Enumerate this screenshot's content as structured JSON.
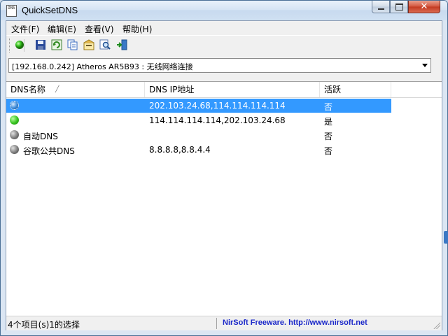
{
  "window": {
    "title": "QuickSetDNS",
    "icon_text": "DNS"
  },
  "menu": [
    "文件(F)",
    "编辑(E)",
    "查看(V)",
    "帮助(H)"
  ],
  "toolbar": [
    "activate-icon",
    "save-icon",
    "refresh-icon",
    "copy-icon",
    "properties-icon",
    "find-icon",
    "exit-icon"
  ],
  "adapter_select": {
    "value": "[192.168.0.242]  Atheros AR5B93 : 无线网络连接"
  },
  "columns": {
    "name": "DNS名称",
    "ip": "DNS IP地址",
    "active": "活跃"
  },
  "rows": [
    {
      "name": "",
      "ip": "202.103.24.68,114.114.114.114",
      "active": "否",
      "status": "blue",
      "selected": true
    },
    {
      "name": "",
      "ip": "114.114.114.114,202.103.24.68",
      "active": "是",
      "status": "green",
      "selected": false
    },
    {
      "name": "自动DNS",
      "ip": "",
      "active": "否",
      "status": "grey",
      "selected": false
    },
    {
      "name": "谷歌公共DNS",
      "ip": "8.8.8.8,8.8.4.4",
      "active": "否",
      "status": "grey",
      "selected": false
    }
  ],
  "status": {
    "left": "4个项目(s)1的选择",
    "right": "NirSoft Freeware.  http://www.nirsoft.net"
  },
  "colors": {
    "selection": "#3399ff",
    "link": "#1a27c9"
  }
}
